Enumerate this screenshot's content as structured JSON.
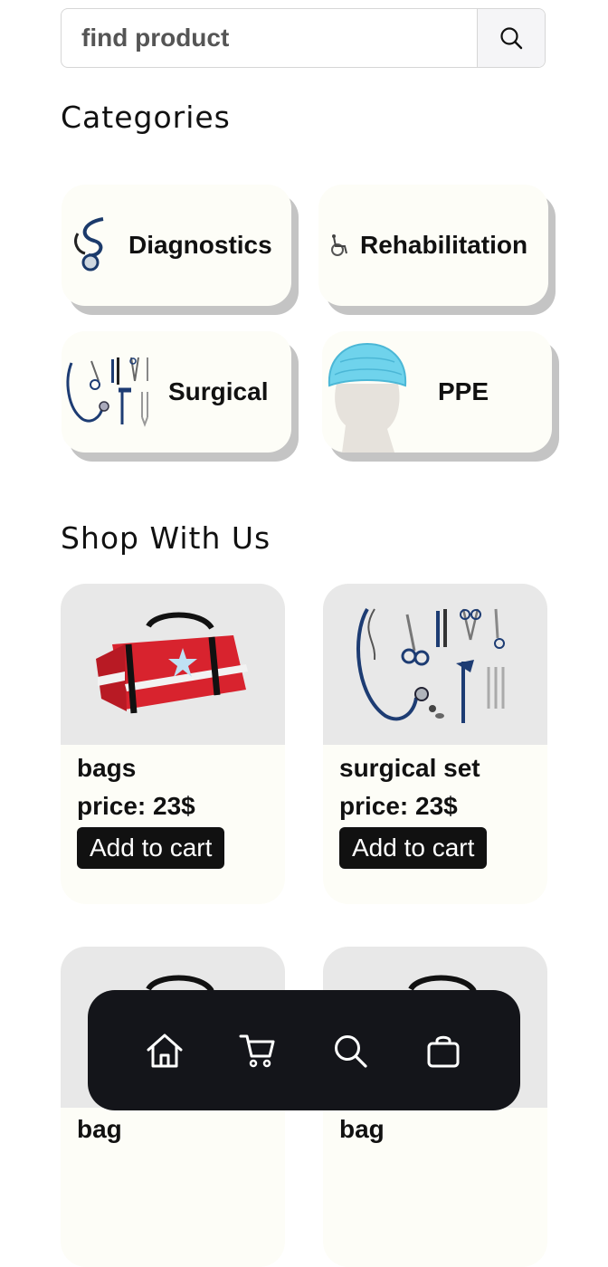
{
  "search": {
    "placeholder": "find product",
    "icon": "search-icon"
  },
  "sections": {
    "categories": "Categories",
    "shop": "Shop With Us"
  },
  "categories": [
    {
      "label": "Diagnostics",
      "icon": "stethoscope-icon"
    },
    {
      "label": "Rehabilitation",
      "icon": "wheelchair-icon"
    },
    {
      "label": "Surgical",
      "icon": "surgical-tools-icon"
    },
    {
      "label": "PPE",
      "icon": "hairnet-icon"
    }
  ],
  "products": [
    {
      "name": "bags",
      "price": "price: 23$",
      "button": "Add to cart",
      "image": "medical-bag"
    },
    {
      "name": "surgical set",
      "price": "price: 23$",
      "button": "Add to cart",
      "image": "surgical-set"
    },
    {
      "name": "bag",
      "image": "medical-bag"
    },
    {
      "name": "bag",
      "image": "medical-bag"
    }
  ],
  "nav": [
    "home-icon",
    "cart-icon",
    "search-icon",
    "bag-icon"
  ],
  "colors": {
    "accent": "#111111",
    "card": "#fdfdf7",
    "shadow": "#c4c4c4",
    "nav_bg": "#14151a",
    "bag_red": "#d8232e"
  }
}
